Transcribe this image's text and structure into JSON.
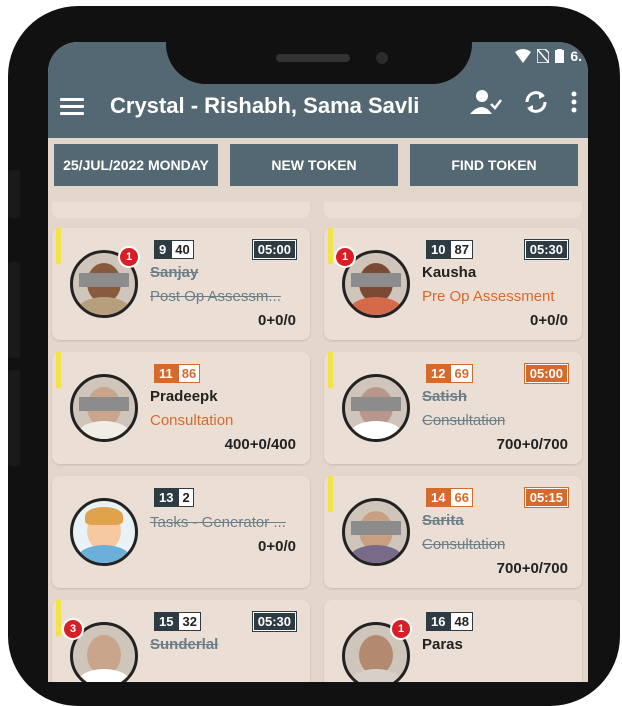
{
  "status_bar": {
    "wifi_icon": "wifi-icon",
    "sim_icon": "no-sim-icon",
    "battery_icon": "battery-icon",
    "time": "6."
  },
  "app_bar": {
    "title": "Crystal - Rishabh, Sama Savli",
    "menu_icon": "menu-icon",
    "user_icon": "user-check-icon",
    "sync_icon": "sync-icon",
    "more_icon": "more-vert-icon"
  },
  "toolbar": {
    "date": "25/JUL/2022 MONDAY",
    "new_token": "NEW TOKEN",
    "find_token": "FIND TOKEN"
  },
  "colors": {
    "appbar": "#546873",
    "background": "#e3d6cb",
    "card": "#ebdfd5",
    "orange": "#d66a2c",
    "dark": "#2e3b43",
    "badge": "#d81f26",
    "bar": "#f2e34a"
  },
  "cards": [
    {
      "token": "9",
      "count": "40",
      "time": "05:00",
      "name": "Sanjay",
      "service": "Post Op Assessm...",
      "amount": "0+0/0",
      "badge": "1",
      "struck": true,
      "orange": false,
      "yellow_bar": true
    },
    {
      "token": "10",
      "count": "87",
      "time": "05:30",
      "name": "Kausha",
      "service": "Pre Op Assessment",
      "amount": "0+0/0",
      "badge": "1",
      "struck": false,
      "orange": false,
      "yellow_bar": true
    },
    {
      "token": "11",
      "count": "86",
      "time": "",
      "name": "Pradeepk",
      "service": "Consultation",
      "amount": "400+0/400",
      "badge": "",
      "struck": false,
      "orange": true,
      "yellow_bar": true
    },
    {
      "token": "12",
      "count": "69",
      "time": "05:00",
      "name": "Satish",
      "service": "Consultation",
      "amount": "700+0/700",
      "badge": "",
      "struck": true,
      "orange": true,
      "yellow_bar": true
    },
    {
      "token": "13",
      "count": "2",
      "time": "",
      "name": "",
      "service": "Tasks - Generator ...",
      "amount": "0+0/0",
      "badge": "",
      "struck": true,
      "orange": false,
      "yellow_bar": false
    },
    {
      "token": "14",
      "count": "66",
      "time": "05:15",
      "name": "Sarita",
      "service": "Consultation",
      "amount": "700+0/700",
      "badge": "",
      "struck": true,
      "orange": true,
      "yellow_bar": true
    },
    {
      "token": "15",
      "count": "32",
      "time": "05:30",
      "name": "Sunderlal",
      "service": "",
      "amount": "",
      "badge": "3",
      "struck": true,
      "orange": false,
      "yellow_bar": true
    },
    {
      "token": "16",
      "count": "48",
      "time": "",
      "name": "Paras",
      "service": "",
      "amount": "",
      "badge": "1",
      "struck": false,
      "orange": false,
      "yellow_bar": false
    }
  ]
}
